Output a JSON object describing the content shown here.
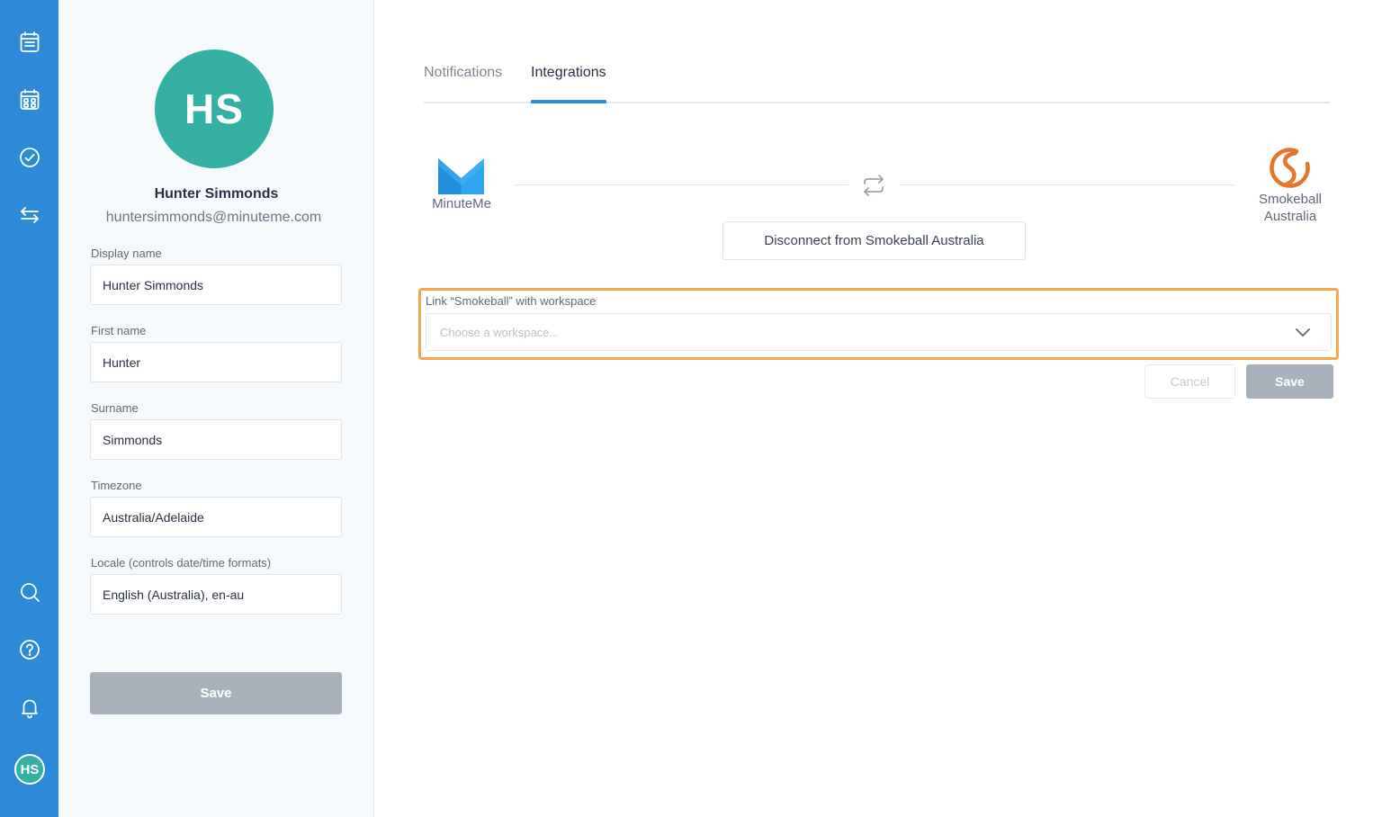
{
  "colors": {
    "rail": "#2d8ad9",
    "avatar": "#35b0a5",
    "accent_tab": "#2d8ad9",
    "highlight": "#f5a849",
    "smokeball_brand": "#e8742a",
    "minuteme_brand": "#2d9ae8",
    "disabled_button": "#a9b1bb"
  },
  "rail": {
    "icons": [
      "list-icon",
      "calendar-icon",
      "check-circle-icon",
      "swap-arrows-icon",
      "search-icon",
      "help-icon",
      "bell-icon"
    ],
    "avatar_initials": "HS"
  },
  "profile": {
    "initials": "HS",
    "name": "Hunter Simmonds",
    "email": "huntersimmonds@minuteme.com",
    "fields": [
      {
        "label": "Display name",
        "value": "Hunter Simmonds"
      },
      {
        "label": "First name",
        "value": "Hunter"
      },
      {
        "label": "Surname",
        "value": "Simmonds"
      },
      {
        "label": "Timezone",
        "value": "Australia/Adelaide"
      },
      {
        "label": "Locale (controls date/time formats)",
        "value": "English (Australia), en-au"
      }
    ],
    "save_label": "Save"
  },
  "tabs": [
    {
      "label": "Notifications",
      "active": false
    },
    {
      "label": "Integrations",
      "active": true
    }
  ],
  "integration": {
    "left_name": "MinuteMe",
    "right_name_line1": "Smokeball",
    "right_name_line2": "Australia",
    "disconnect_label": "Disconnect from Smokeball Australia",
    "link_label": "Link “Smokeball” with workspace",
    "workspace_placeholder": "Choose a workspace...",
    "cancel_label": "Cancel",
    "save_label": "Save"
  }
}
